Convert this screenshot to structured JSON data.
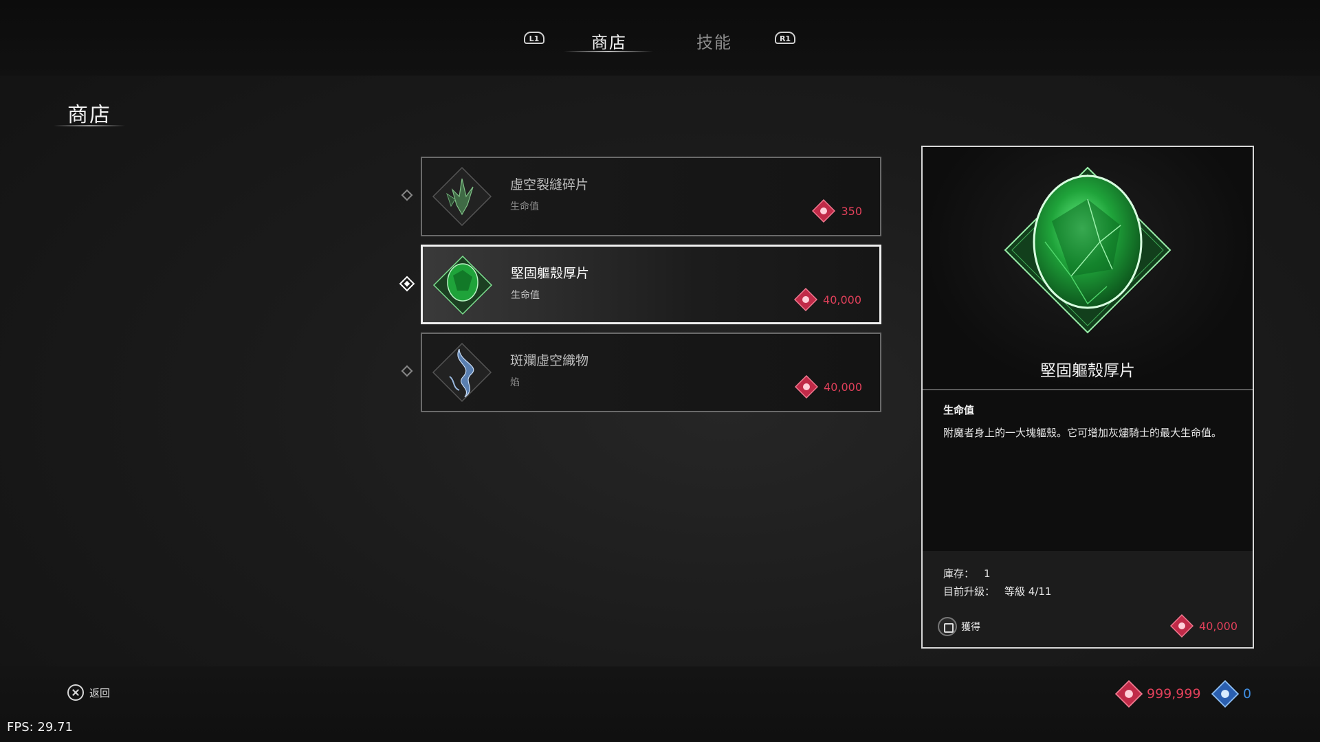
{
  "colors": {
    "accent_red": "#e0405a",
    "accent_blue": "#3f8de0",
    "item_green": "#1fa33a"
  },
  "header": {
    "left_bumper": "L1",
    "right_bumper": "R1",
    "tabs": [
      {
        "label": "商店",
        "active": true
      },
      {
        "label": "技能",
        "active": false
      }
    ]
  },
  "page": {
    "title": "商店"
  },
  "items": [
    {
      "name": "虛空裂縫碎片",
      "category": "生命值",
      "price": "350",
      "icon": "void-shard-icon"
    },
    {
      "name": "堅固軀殼厚片",
      "category": "生命值",
      "price": "40,000",
      "icon": "green-gem-icon",
      "selected": true
    },
    {
      "name": "斑斕虛空織物",
      "category": "焰",
      "price": "40,000",
      "icon": "void-cloth-icon"
    }
  ],
  "detail": {
    "name": "堅固軀殼厚片",
    "category": "生命值",
    "description": "附魔者身上的一大塊軀殼。它可增加灰燼騎士的最大生命值。",
    "stock_label": "庫存：",
    "stock_value": "1",
    "upgrade_label": "目前升級：",
    "upgrade_value": "等級 4/11",
    "acquire_label": "獲得",
    "price": "40,000"
  },
  "footer": {
    "back_label": "返回",
    "currency_red": "999,999",
    "currency_blue": "0"
  },
  "fps": "FPS: 29.71"
}
